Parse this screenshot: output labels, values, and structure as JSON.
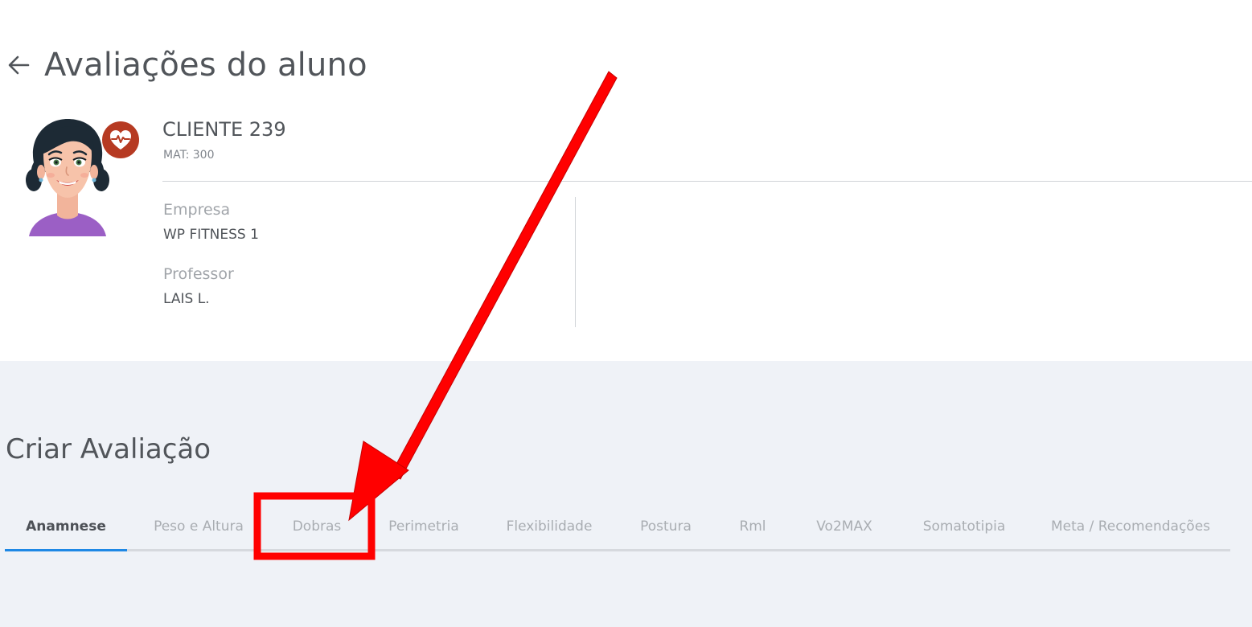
{
  "page": {
    "title": "Avaliações do aluno",
    "back_icon": "arrow-left-icon"
  },
  "client": {
    "name": "CLIENTE 239",
    "mat": "MAT: 300",
    "avatar_icon": "woman-avatar",
    "badge_icon": "heart-pulse-icon",
    "badge_color": "#b63a22"
  },
  "info": {
    "empresa_label": "Empresa",
    "empresa_value": "WP FITNESS 1",
    "professor_label": "Professor",
    "professor_value": "LAIS L."
  },
  "section": {
    "title": "Criar Avaliação"
  },
  "tabs": [
    {
      "label": "Anamnese",
      "active": true
    },
    {
      "label": "Peso e Altura",
      "active": false
    },
    {
      "label": "Dobras",
      "active": false
    },
    {
      "label": "Perimetria",
      "active": false
    },
    {
      "label": "Flexibilidade",
      "active": false
    },
    {
      "label": "Postura",
      "active": false
    },
    {
      "label": "Rml",
      "active": false
    },
    {
      "label": "Vo2MAX",
      "active": false
    },
    {
      "label": "Somatotipia",
      "active": false
    },
    {
      "label": "Meta / Recomendações",
      "active": false
    }
  ],
  "colors": {
    "accent": "#1e88e5",
    "annotation": "#ff0000",
    "content_background": "#eff2f7"
  },
  "annotation": {
    "type": "red-arrow-and-box",
    "target": "Dobras"
  }
}
